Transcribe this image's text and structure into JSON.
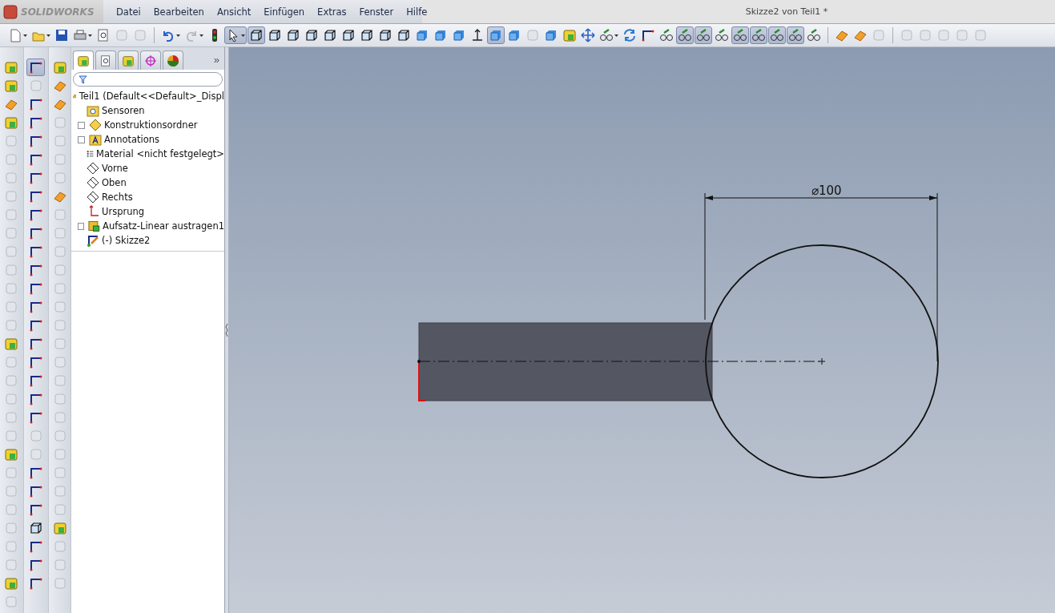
{
  "app": {
    "logo": "SOLIDWORKS",
    "menu": [
      "Datei",
      "Bearbeiten",
      "Ansicht",
      "Einfügen",
      "Extras",
      "Fenster",
      "Hilfe"
    ],
    "title": "Skizze2 von Teil1 *"
  },
  "toolbar": [
    [
      {
        "kind": "doc",
        "selected": false,
        "dropdown": true
      },
      {
        "kind": "open",
        "selected": false,
        "dropdown": true
      },
      {
        "kind": "save",
        "selected": false,
        "dropdown": false
      },
      {
        "kind": "print",
        "selected": false,
        "dropdown": true
      },
      {
        "kind": "preview",
        "selected": false,
        "dropdown": false
      },
      {
        "kind": "faded",
        "selected": false,
        "dropdown": false
      },
      {
        "kind": "faded",
        "selected": false,
        "dropdown": false
      }
    ],
    [
      {
        "kind": "undo",
        "selected": false,
        "dropdown": true
      },
      {
        "kind": "redo",
        "selected": false,
        "dropdown": true
      },
      {
        "kind": "light",
        "selected": false,
        "dropdown": false
      },
      {
        "kind": "pointer",
        "selected": true,
        "dropdown": true
      },
      {
        "kind": "wire",
        "selected": true,
        "dropdown": false
      },
      {
        "kind": "wire",
        "selected": false,
        "dropdown": false
      },
      {
        "kind": "wire",
        "selected": false,
        "dropdown": false
      },
      {
        "kind": "wire",
        "selected": false,
        "dropdown": false
      },
      {
        "kind": "wire",
        "selected": false,
        "dropdown": false
      },
      {
        "kind": "wire",
        "selected": false,
        "dropdown": false
      },
      {
        "kind": "wire",
        "selected": false,
        "dropdown": false
      },
      {
        "kind": "wire",
        "selected": false,
        "dropdown": false
      },
      {
        "kind": "wire",
        "selected": false,
        "dropdown": false
      },
      {
        "kind": "solid",
        "selected": false,
        "dropdown": false
      },
      {
        "kind": "solid",
        "selected": false,
        "dropdown": false
      },
      {
        "kind": "solid",
        "selected": false,
        "dropdown": false
      },
      {
        "kind": "axis",
        "selected": false,
        "dropdown": false
      },
      {
        "kind": "solid",
        "selected": true,
        "dropdown": false
      },
      {
        "kind": "solid",
        "selected": false,
        "dropdown": false
      },
      {
        "kind": "faded",
        "selected": false,
        "dropdown": false
      },
      {
        "kind": "solid",
        "selected": false,
        "dropdown": false
      },
      {
        "kind": "color",
        "selected": false,
        "dropdown": false
      },
      {
        "kind": "arrows",
        "selected": false,
        "dropdown": false
      },
      {
        "kind": "glasses",
        "selected": false,
        "dropdown": true
      },
      {
        "kind": "refresh",
        "selected": false,
        "dropdown": false
      },
      {
        "kind": "sketch",
        "selected": false,
        "dropdown": false
      },
      {
        "kind": "glasses",
        "selected": false,
        "dropdown": false
      },
      {
        "kind": "glasses",
        "selected": true,
        "dropdown": false
      },
      {
        "kind": "glasses",
        "selected": true,
        "dropdown": false
      },
      {
        "kind": "glasses",
        "selected": false,
        "dropdown": false
      },
      {
        "kind": "glasses",
        "selected": true,
        "dropdown": false
      },
      {
        "kind": "glasses",
        "selected": true,
        "dropdown": false
      },
      {
        "kind": "glasses",
        "selected": true,
        "dropdown": false
      },
      {
        "kind": "glasses",
        "selected": true,
        "dropdown": false
      },
      {
        "kind": "glasses",
        "selected": false,
        "dropdown": false
      }
    ],
    [
      {
        "kind": "orange",
        "selected": false,
        "dropdown": false
      },
      {
        "kind": "orange",
        "selected": false,
        "dropdown": false
      },
      {
        "kind": "faded",
        "selected": false,
        "dropdown": false
      }
    ],
    [
      {
        "kind": "faded",
        "selected": false,
        "dropdown": false
      },
      {
        "kind": "faded",
        "selected": false,
        "dropdown": false
      },
      {
        "kind": "faded",
        "selected": false,
        "dropdown": false
      },
      {
        "kind": "faded",
        "selected": false,
        "dropdown": false
      },
      {
        "kind": "faded",
        "selected": false,
        "dropdown": false
      }
    ]
  ],
  "side_toolbars": [
    {
      "items": [
        {
          "kind": "color",
          "selected": false
        },
        {
          "kind": "color",
          "selected": false
        },
        {
          "kind": "orange",
          "selected": false
        },
        {
          "kind": "color",
          "selected": false
        },
        {
          "kind": "faded",
          "selected": false
        },
        {
          "kind": "faded",
          "selected": false
        },
        {
          "kind": "faded",
          "selected": false
        },
        {
          "kind": "faded",
          "selected": false
        },
        {
          "kind": "faded",
          "selected": false
        },
        {
          "kind": "faded",
          "selected": false
        },
        {
          "kind": "faded",
          "selected": false
        },
        {
          "kind": "faded",
          "selected": false
        },
        {
          "kind": "faded",
          "selected": false
        },
        {
          "kind": "faded",
          "selected": false
        },
        {
          "kind": "faded",
          "selected": false
        },
        {
          "kind": "color",
          "selected": false
        },
        {
          "kind": "faded",
          "selected": false
        },
        {
          "kind": "faded",
          "selected": false
        },
        {
          "kind": "faded",
          "selected": false
        },
        {
          "kind": "faded",
          "selected": false
        },
        {
          "kind": "faded",
          "selected": false
        },
        {
          "kind": "color",
          "selected": false
        },
        {
          "kind": "faded",
          "selected": false
        },
        {
          "kind": "faded",
          "selected": false
        },
        {
          "kind": "faded",
          "selected": false
        },
        {
          "kind": "faded",
          "selected": false
        },
        {
          "kind": "faded",
          "selected": false
        },
        {
          "kind": "faded",
          "selected": false
        },
        {
          "kind": "color",
          "selected": false
        },
        {
          "kind": "faded",
          "selected": false
        }
      ]
    },
    {
      "items": [
        {
          "kind": "sketch",
          "selected": true
        },
        {
          "kind": "faded",
          "selected": false
        },
        {
          "kind": "sketch",
          "selected": false
        },
        {
          "kind": "sketch",
          "selected": false
        },
        {
          "kind": "sketch",
          "selected": false
        },
        {
          "kind": "sketch",
          "selected": false
        },
        {
          "kind": "sketch",
          "selected": false
        },
        {
          "kind": "sketch",
          "selected": false
        },
        {
          "kind": "sketch",
          "selected": false
        },
        {
          "kind": "sketch",
          "selected": false
        },
        {
          "kind": "sketch",
          "selected": false
        },
        {
          "kind": "sketch",
          "selected": false
        },
        {
          "kind": "sketch",
          "selected": false
        },
        {
          "kind": "sketch",
          "selected": false
        },
        {
          "kind": "sketch",
          "selected": false
        },
        {
          "kind": "sketch",
          "selected": false
        },
        {
          "kind": "sketch",
          "selected": false
        },
        {
          "kind": "sketch",
          "selected": false
        },
        {
          "kind": "sketch",
          "selected": false
        },
        {
          "kind": "sketch",
          "selected": false
        },
        {
          "kind": "faded",
          "selected": false
        },
        {
          "kind": "faded",
          "selected": false
        },
        {
          "kind": "sketch",
          "selected": false
        },
        {
          "kind": "sketch",
          "selected": false
        },
        {
          "kind": "sketch",
          "selected": false
        },
        {
          "kind": "wire",
          "selected": false
        },
        {
          "kind": "sketch",
          "selected": false
        },
        {
          "kind": "sketch",
          "selected": false
        },
        {
          "kind": "sketch",
          "selected": false
        }
      ]
    },
    {
      "items": [
        {
          "kind": "color",
          "selected": false
        },
        {
          "kind": "orange",
          "selected": false
        },
        {
          "kind": "orange",
          "selected": false
        },
        {
          "kind": "faded",
          "selected": false
        },
        {
          "kind": "faded",
          "selected": false
        },
        {
          "kind": "faded",
          "selected": false
        },
        {
          "kind": "faded",
          "selected": false
        },
        {
          "kind": "orange",
          "selected": false
        },
        {
          "kind": "faded",
          "selected": false
        },
        {
          "kind": "faded",
          "selected": false
        },
        {
          "kind": "faded",
          "selected": false
        },
        {
          "kind": "faded",
          "selected": false
        },
        {
          "kind": "faded",
          "selected": false
        },
        {
          "kind": "faded",
          "selected": false
        },
        {
          "kind": "faded",
          "selected": false
        },
        {
          "kind": "faded",
          "selected": false
        },
        {
          "kind": "faded",
          "selected": false
        },
        {
          "kind": "faded",
          "selected": false
        },
        {
          "kind": "faded",
          "selected": false
        },
        {
          "kind": "faded",
          "selected": false
        },
        {
          "kind": "faded",
          "selected": false
        },
        {
          "kind": "faded",
          "selected": false
        },
        {
          "kind": "faded",
          "selected": false
        },
        {
          "kind": "faded",
          "selected": false
        },
        {
          "kind": "faded",
          "selected": false
        },
        {
          "kind": "color",
          "selected": false
        },
        {
          "kind": "faded",
          "selected": false
        },
        {
          "kind": "faded",
          "selected": false
        },
        {
          "kind": "faded",
          "selected": false
        }
      ]
    }
  ],
  "manager_tabs": [
    {
      "kind": "feature",
      "selected": true
    },
    {
      "kind": "property",
      "selected": false
    },
    {
      "kind": "config",
      "selected": false
    },
    {
      "kind": "dimxpert",
      "selected": false
    },
    {
      "kind": "display",
      "selected": false
    }
  ],
  "manager_more": "»",
  "feature_tree": {
    "label": "Teil1  (Default<<Default>_Displ",
    "kind": "part",
    "children": [
      {
        "label": "Sensoren",
        "kind": "sensor",
        "expandable": false
      },
      {
        "label": "Konstruktionsordner",
        "kind": "folder",
        "expandable": true
      },
      {
        "label": "Annotations",
        "kind": "annotation",
        "expandable": true
      },
      {
        "label": "Material <nicht festgelegt>",
        "kind": "material",
        "expandable": false
      },
      {
        "label": "Vorne",
        "kind": "plane",
        "expandable": false
      },
      {
        "label": "Oben",
        "kind": "plane",
        "expandable": false
      },
      {
        "label": "Rechts",
        "kind": "plane",
        "expandable": false
      },
      {
        "label": "Ursprung",
        "kind": "origin",
        "expandable": false
      },
      {
        "label": "Aufsatz-Linear austragen1",
        "kind": "extrude",
        "expandable": true
      },
      {
        "label": "(-) Skizze2",
        "kind": "sketch",
        "expandable": false
      }
    ]
  },
  "graphics": {
    "dimension": "⌀100"
  }
}
